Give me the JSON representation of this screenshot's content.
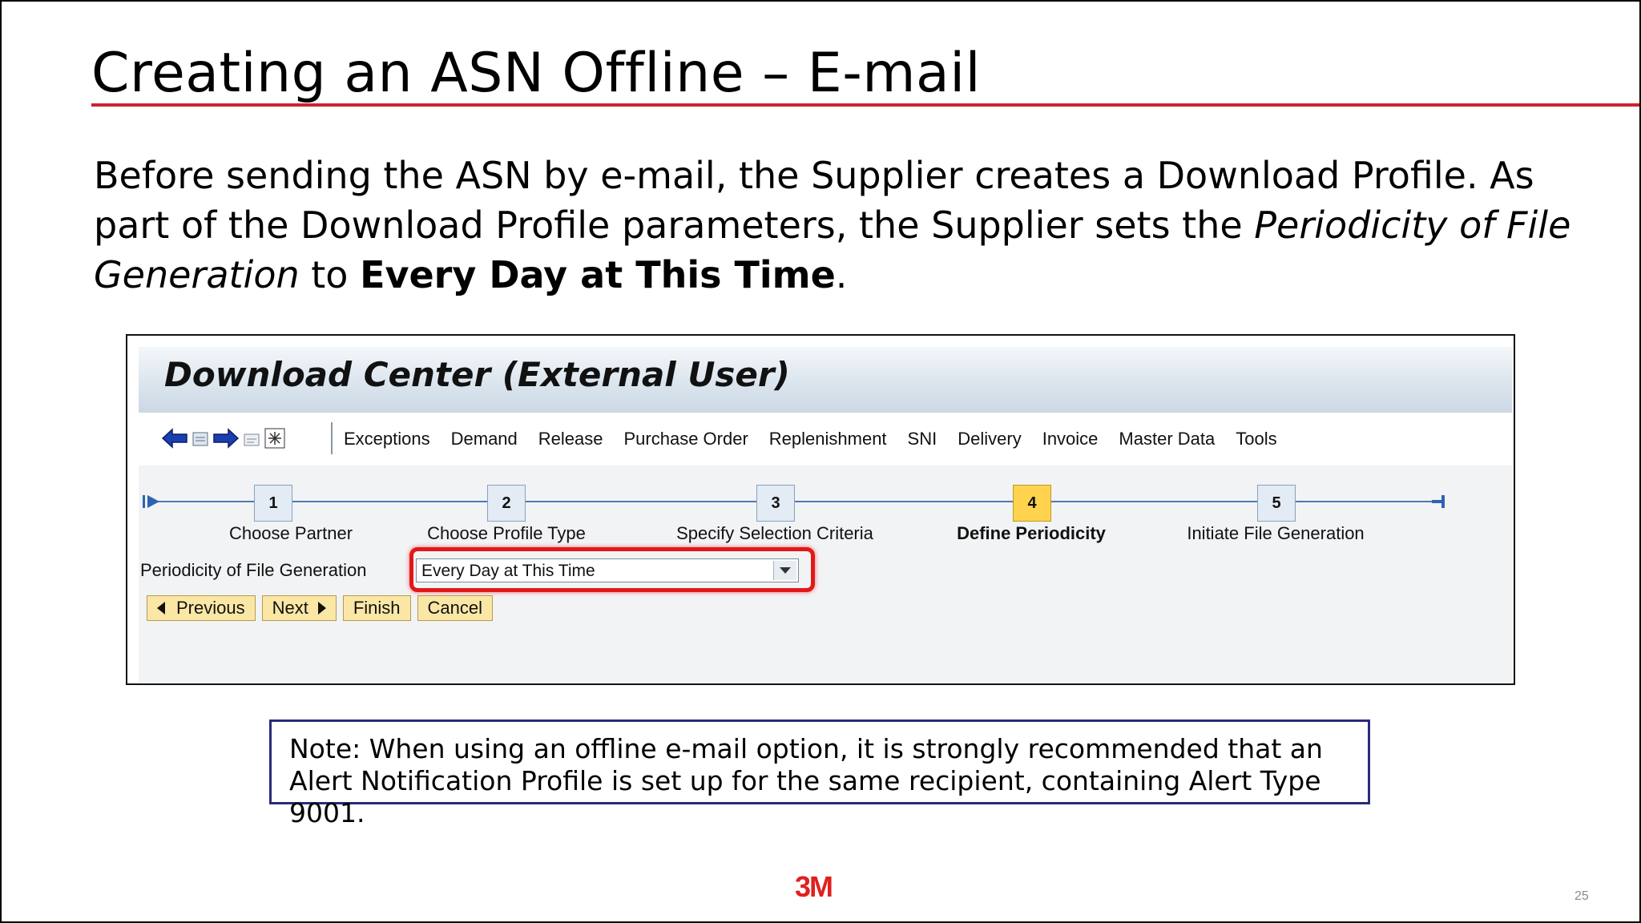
{
  "slide": {
    "title": "Creating an ASN Offline – E-mail",
    "intro_part1": "Before sending the ASN by e-mail, the Supplier creates a Download Profile. As part of the Download Profile parameters, the Supplier sets the ",
    "intro_italic": "Periodicity of File Generation",
    "intro_part2": " to ",
    "intro_bold": "Every Day at This Time",
    "intro_end": ".",
    "note": "Note: When using an offline e-mail option, it is strongly recommended that an Alert Notification Profile is set up for the same recipient, containing Alert Type 9001.",
    "logo": "3M",
    "page_number": "25",
    "accent_color": "#d0202e"
  },
  "app": {
    "title": "Download Center (External User)",
    "toolbar_icons": [
      "back-arrow-icon",
      "save-icon",
      "forward-arrow-icon",
      "print-icon",
      "expand-icon"
    ],
    "menu": [
      "Exceptions",
      "Demand",
      "Release",
      "Purchase Order",
      "Replenishment",
      "SNI",
      "Delivery",
      "Invoice",
      "Master Data",
      "Tools"
    ],
    "steps": [
      {
        "number": "1",
        "label": "Choose Partner"
      },
      {
        "number": "2",
        "label": "Choose Profile Type"
      },
      {
        "number": "3",
        "label": "Specify Selection Criteria"
      },
      {
        "number": "4",
        "label": "Define Periodicity"
      },
      {
        "number": "5",
        "label": "Initiate File Generation"
      }
    ],
    "active_step": "4",
    "field_label": "Periodicity of File Generation",
    "field_value": "Every Day at This Time",
    "buttons": {
      "previous": "Previous",
      "next": "Next",
      "finish": "Finish",
      "cancel": "Cancel"
    }
  }
}
